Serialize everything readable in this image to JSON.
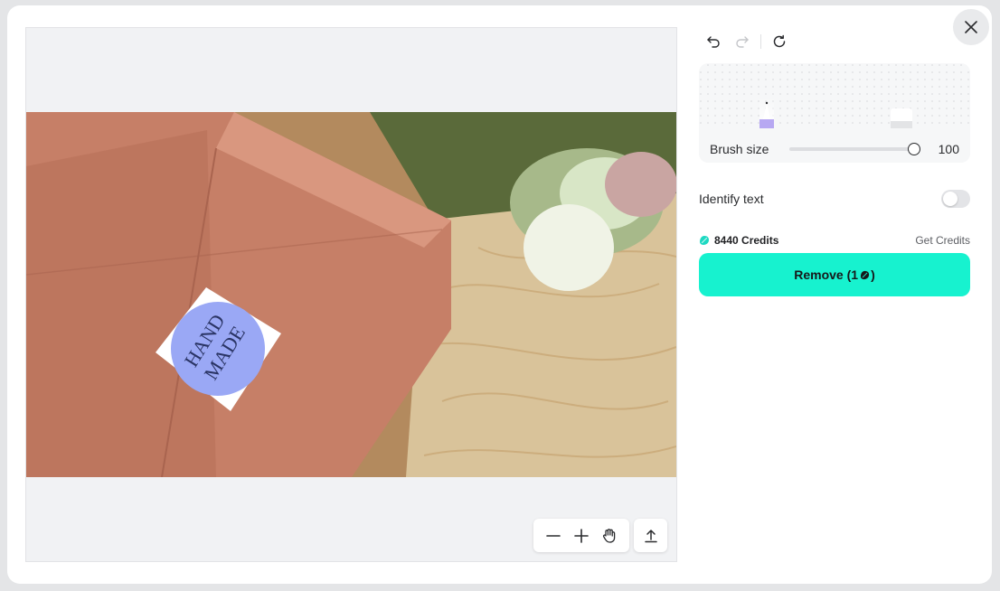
{
  "colors": {
    "accent": "#17f2cf",
    "mask": "#9aa8f5",
    "credit_gem": "#1dd9c2"
  },
  "toolbar": {
    "undo_icon": "undo-icon",
    "redo_icon": "redo-icon",
    "reset_icon": "reset-icon"
  },
  "brush": {
    "label": "Brush size",
    "value": "100",
    "fraction": 1.0
  },
  "identify_text": {
    "label": "Identify text",
    "enabled": false
  },
  "credits": {
    "amount": "8440 Credits",
    "get_label": "Get Credits"
  },
  "remove_button": {
    "prefix": "Remove (1",
    "suffix": ")"
  },
  "canvas": {
    "sticker_line1": "HAND",
    "sticker_line2": "MADE"
  },
  "canvas_tools": [
    "zoom-out-icon",
    "zoom-in-icon",
    "hand-pan-icon",
    "export-icon"
  ]
}
